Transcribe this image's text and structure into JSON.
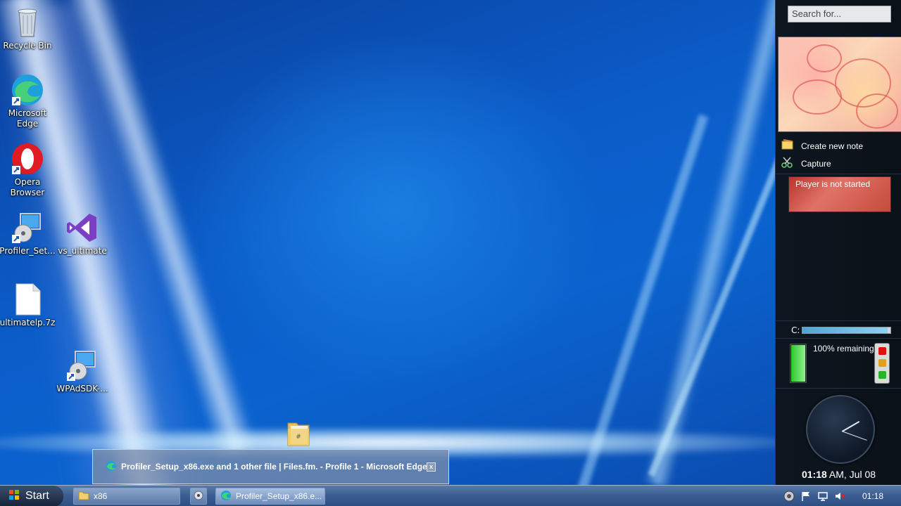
{
  "desktop": {
    "icons": [
      {
        "label": "Recycle Bin"
      },
      {
        "label": "Microsoft Edge"
      },
      {
        "label": "Opera Browser"
      },
      {
        "label": "Profiler_Set..."
      },
      {
        "label": "vs_ultimate"
      },
      {
        "label": "ultimatelp.7z"
      },
      {
        "label": "WPAdSDK-..."
      }
    ]
  },
  "sidebar": {
    "search_placeholder": "Search for...",
    "notes": {
      "create_label": "Create new note",
      "capture_label": "Capture"
    },
    "player_status": "Player is not started",
    "drive": {
      "label": "C:",
      "used_fraction": 0.97
    },
    "battery": {
      "text": "100% remaining",
      "level_percent": 100
    },
    "clock": {
      "time": "01:18",
      "suffix": "AM, Jul 08"
    }
  },
  "taskbar": {
    "start_label": "Start",
    "buttons": [
      {
        "label": "x86"
      },
      {
        "label": "Profiler_Setup_x86.e..."
      }
    ],
    "tray_time": "01:18"
  },
  "tooltip": {
    "title": "Profiler_Setup_x86.exe and 1 other file | Files.fm. - Profile 1 - Microsoft Edge",
    "close_glyph": "x"
  },
  "colors": {
    "accent": "#0b5cc9",
    "taskbar": "#3c5f93"
  }
}
